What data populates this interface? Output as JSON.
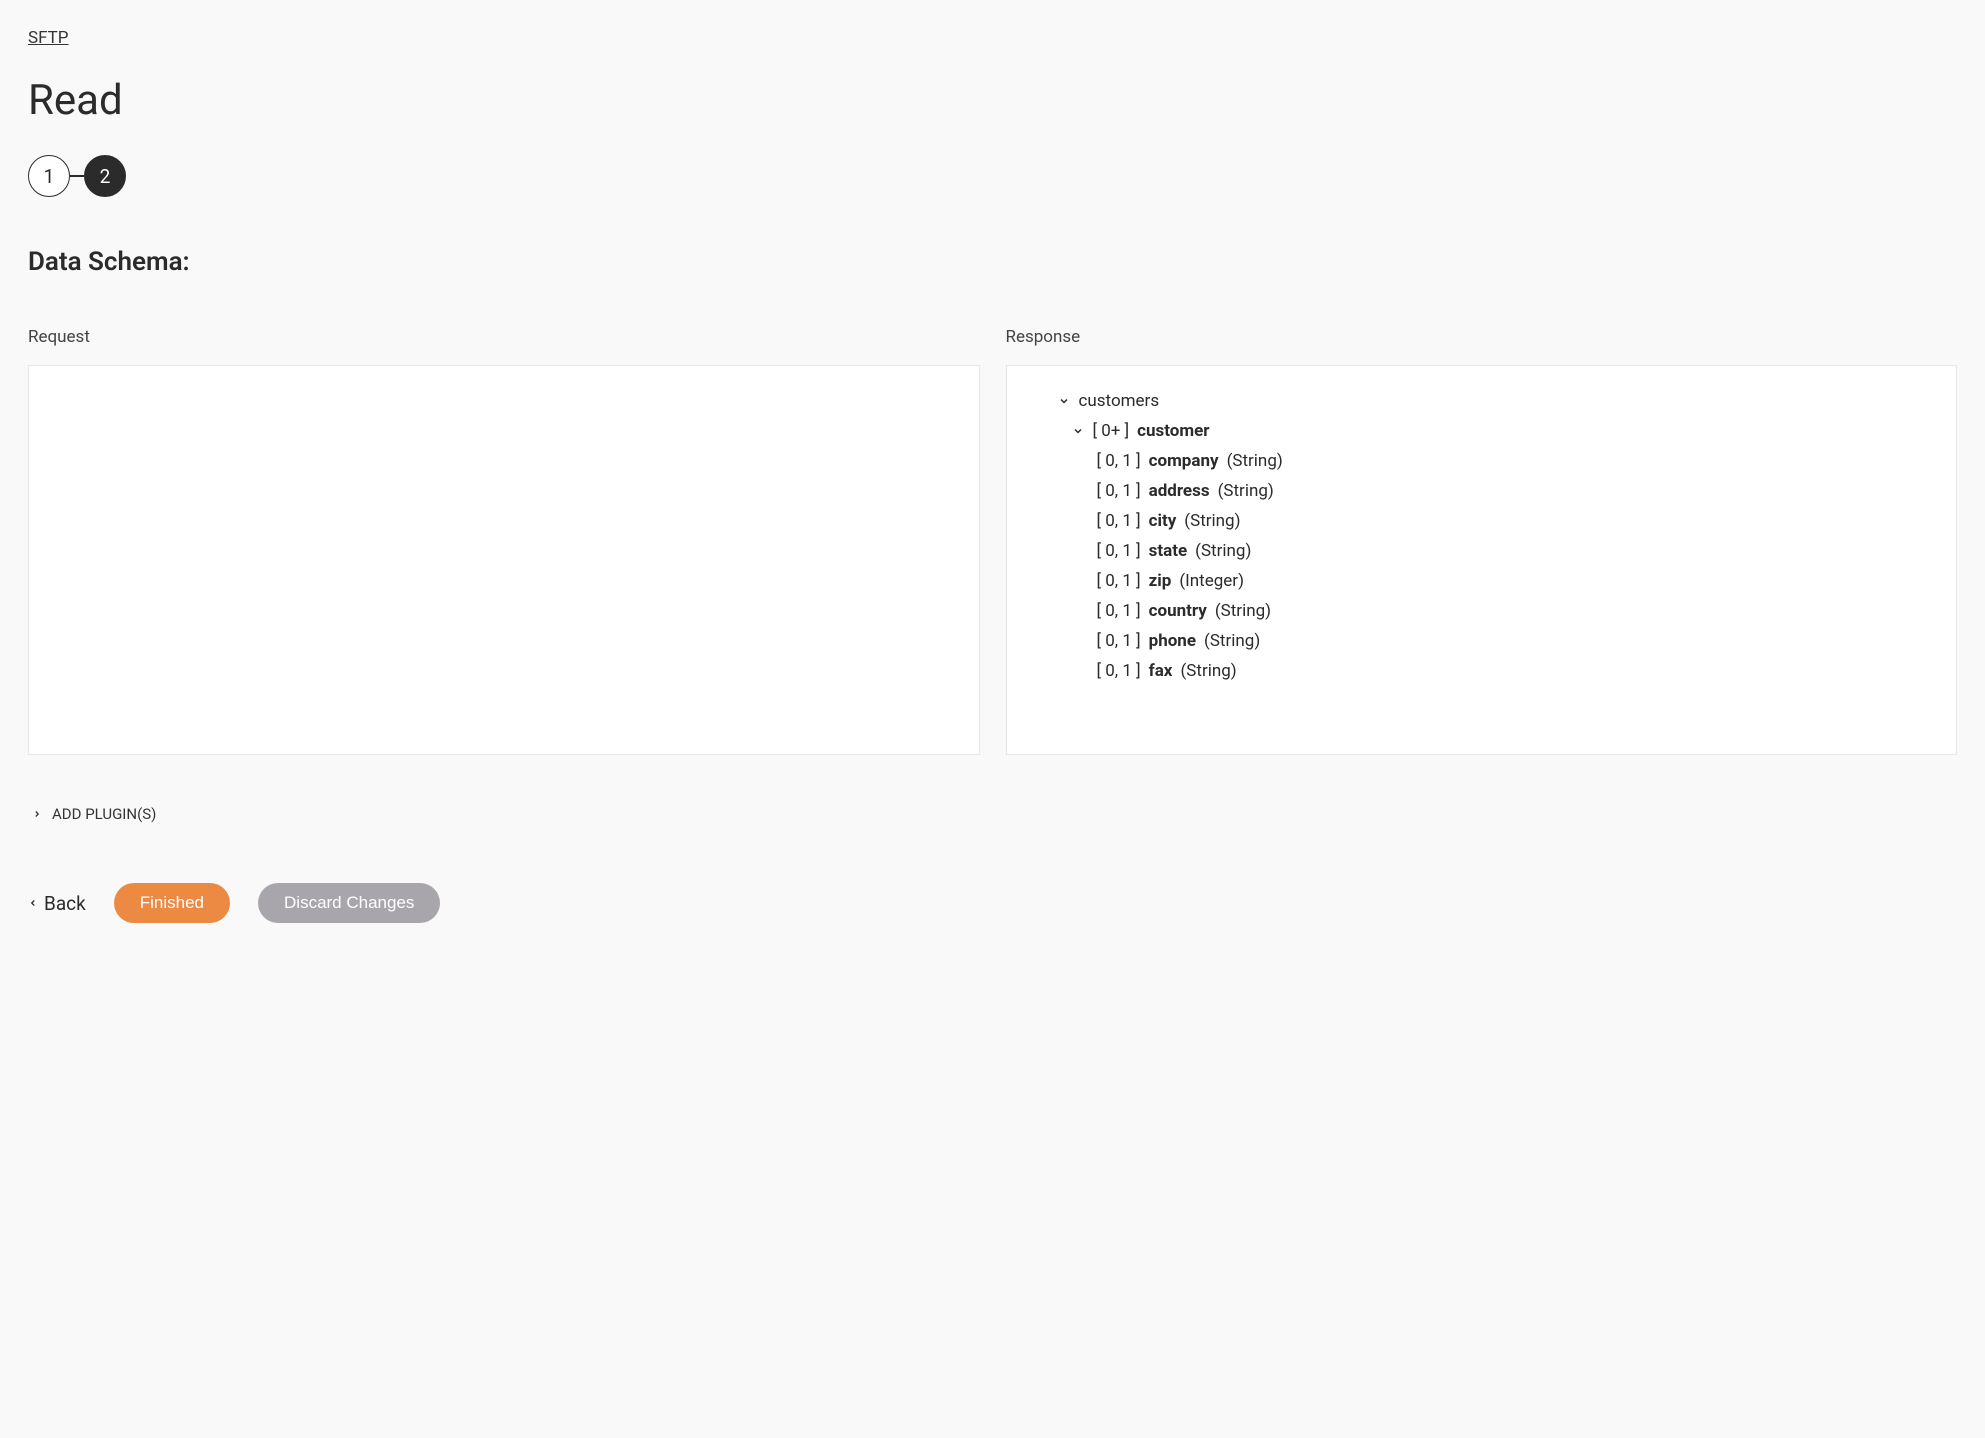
{
  "breadcrumb": "SFTP",
  "page_title": "Read",
  "stepper": {
    "step1": "1",
    "step2": "2"
  },
  "section_heading": "Data Schema:",
  "panels": {
    "request_label": "Request",
    "response_label": "Response"
  },
  "schema": {
    "root": {
      "name": "customers"
    },
    "child": {
      "card": "[ 0+ ]",
      "name": "customer"
    },
    "fields": [
      {
        "card": "[ 0, 1 ]",
        "name": "company",
        "type": "(String)"
      },
      {
        "card": "[ 0, 1 ]",
        "name": "address",
        "type": "(String)"
      },
      {
        "card": "[ 0, 1 ]",
        "name": "city",
        "type": "(String)"
      },
      {
        "card": "[ 0, 1 ]",
        "name": "state",
        "type": "(String)"
      },
      {
        "card": "[ 0, 1 ]",
        "name": "zip",
        "type": "(Integer)"
      },
      {
        "card": "[ 0, 1 ]",
        "name": "country",
        "type": "(String)"
      },
      {
        "card": "[ 0, 1 ]",
        "name": "phone",
        "type": "(String)"
      },
      {
        "card": "[ 0, 1 ]",
        "name": "fax",
        "type": "(String)"
      }
    ]
  },
  "add_plugins_label": "ADD PLUGIN(S)",
  "footer": {
    "back": "Back",
    "finished": "Finished",
    "discard": "Discard Changes"
  },
  "colors": {
    "primary_button": "#ec8a44",
    "secondary_button": "#a8a6aa"
  }
}
